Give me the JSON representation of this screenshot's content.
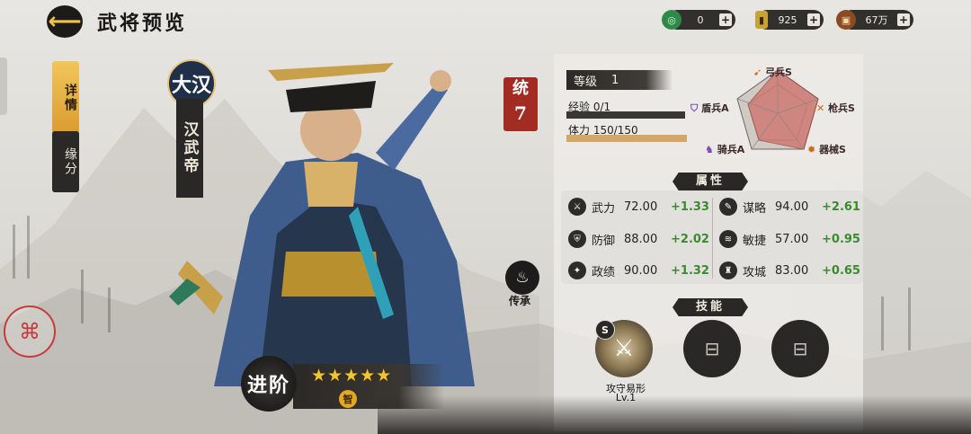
{
  "header": {
    "back_icon": "back-arrow-icon",
    "title": "武将预览"
  },
  "resources": [
    {
      "icon": "jade-coin-icon",
      "value": "0"
    },
    {
      "icon": "gold-bar-icon",
      "value": "925"
    },
    {
      "icon": "copper-coin-icon",
      "value": "67万"
    }
  ],
  "tabs": [
    {
      "label": "详情",
      "active": true
    },
    {
      "label": "缘分",
      "active": false
    }
  ],
  "hero": {
    "dynasty": "大汉",
    "name": "汉武帝",
    "lead_label": "统",
    "lead_value": "7",
    "inherit_label": "传承",
    "advance_label": "进阶",
    "stars": 5,
    "stars_text": "★★★★★",
    "trait": "智"
  },
  "stats": {
    "level_label": "等级",
    "level": "1",
    "exp_label": "经验",
    "exp_value": "0/1",
    "exp_fraction": 0.0,
    "hp_label": "体力",
    "hp_value": "150/150",
    "hp_fraction": 1.0
  },
  "troops": {
    "archer": "弓兵S",
    "spear": "枪兵S",
    "siege": "器械S",
    "cavalry": "骑兵A",
    "shield": "盾兵A"
  },
  "attributes": {
    "header": "属性",
    "items": [
      {
        "icon": "sword-icon",
        "name": "武力",
        "value": "72.00",
        "bonus": "+1.33"
      },
      {
        "icon": "scroll-icon",
        "name": "谋略",
        "value": "94.00",
        "bonus": "+2.61"
      },
      {
        "icon": "shield-icon",
        "name": "防御",
        "value": "88.00",
        "bonus": "+2.02"
      },
      {
        "icon": "wind-icon",
        "name": "敏捷",
        "value": "57.00",
        "bonus": "+0.95"
      },
      {
        "icon": "seal-icon",
        "name": "政绩",
        "value": "90.00",
        "bonus": "+1.32"
      },
      {
        "icon": "tower-icon",
        "name": "攻城",
        "value": "83.00",
        "bonus": "+0.65"
      }
    ]
  },
  "skills": {
    "header": "技能",
    "main": {
      "badge": "S",
      "name": "攻守易形",
      "level": "Lv.1"
    },
    "empty_slots": 2
  },
  "colors": {
    "accent": "#f0c24a",
    "bonus": "#3b8a2f",
    "stamp": "#a32c22"
  }
}
